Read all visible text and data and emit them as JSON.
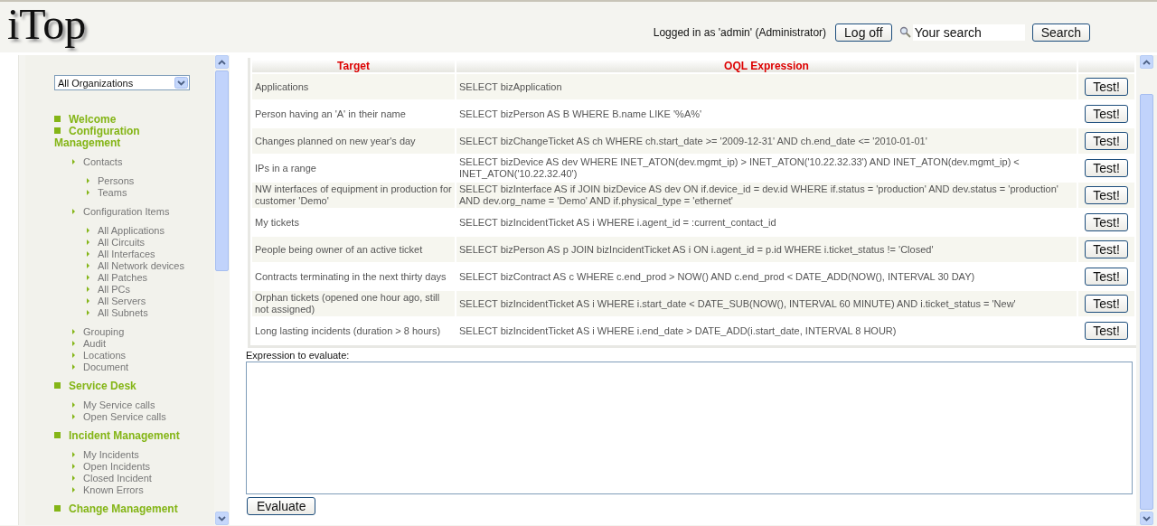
{
  "header": {
    "logo": "iTop",
    "login_text": "Logged in as 'admin' (Administrator)",
    "logoff_button": "Log off",
    "search": {
      "placeholder": "Your search"
    },
    "search_button": "Search"
  },
  "sidebar": {
    "organization_select": "All Organizations",
    "menu": [
      {
        "label": "Welcome"
      },
      {
        "label": "Configuration Management",
        "children": [
          {
            "label": "Contacts",
            "children": [
              {
                "label": "Persons"
              },
              {
                "label": "Teams"
              }
            ]
          },
          {
            "label": "Configuration Items",
            "children": [
              {
                "label": "All Applications"
              },
              {
                "label": "All Circuits"
              },
              {
                "label": "All Interfaces"
              },
              {
                "label": "All Network devices"
              },
              {
                "label": "All Patches"
              },
              {
                "label": "All PCs"
              },
              {
                "label": "All Servers"
              },
              {
                "label": "All Subnets"
              }
            ]
          },
          {
            "label": "Grouping"
          },
          {
            "label": "Audit"
          },
          {
            "label": "Locations"
          },
          {
            "label": "Document"
          }
        ]
      },
      {
        "label": "Service Desk",
        "children": [
          {
            "label": "My Service calls"
          },
          {
            "label": "Open Service calls"
          }
        ]
      },
      {
        "label": "Incident Management",
        "children": [
          {
            "label": "My Incidents"
          },
          {
            "label": "Open Incidents"
          },
          {
            "label": "Closed Incident"
          },
          {
            "label": "Known Errors"
          }
        ]
      },
      {
        "label": "Change Management"
      }
    ]
  },
  "queries": {
    "columns": [
      "Target",
      "OQL Expression"
    ],
    "rows": [
      {
        "target": "Applications",
        "expression": "SELECT bizApplication",
        "button": "Test!"
      },
      {
        "target": "Person having an 'A' in their name",
        "expression": "SELECT bizPerson AS B WHERE B.name LIKE '%A%'",
        "button": "Test!"
      },
      {
        "target": "Changes planned on new year's day",
        "expression": "SELECT bizChangeTicket AS ch WHERE ch.start_date >= '2009-12-31' AND ch.end_date <= '2010-01-01'",
        "button": "Test!"
      },
      {
        "target": "IPs in a range",
        "expression": "SELECT bizDevice AS dev WHERE INET_ATON(dev.mgmt_ip) > INET_ATON('10.22.32.33') AND INET_ATON(dev.mgmt_ip) < INET_ATON('10.22.32.40')",
        "button": "Test!"
      },
      {
        "target": "NW interfaces of equipment in production for customer 'Demo'",
        "expression": "SELECT bizInterface AS if JOIN bizDevice AS dev ON if.device_id = dev.id WHERE if.status = 'production' AND dev.status = 'production' AND dev.org_name = 'Demo' AND if.physical_type = 'ethernet'",
        "button": "Test!"
      },
      {
        "target": "My tickets",
        "expression": "SELECT bizIncidentTicket AS i WHERE i.agent_id = :current_contact_id",
        "button": "Test!"
      },
      {
        "target": "People being owner of an active ticket",
        "expression": "SELECT bizPerson AS p JOIN bizIncidentTicket AS i ON i.agent_id = p.id WHERE i.ticket_status != 'Closed'",
        "button": "Test!"
      },
      {
        "target": "Contracts terminating in the next thirty days",
        "expression": "SELECT bizContract AS c WHERE c.end_prod > NOW() AND c.end_prod < DATE_ADD(NOW(), INTERVAL 30 DAY)",
        "button": "Test!"
      },
      {
        "target": "Orphan tickets (opened one hour ago, still not assigned)",
        "expression": "SELECT bizIncidentTicket AS i WHERE i.start_date < DATE_SUB(NOW(), INTERVAL 60 MINUTE) AND i.ticket_status = 'New'",
        "button": "Test!"
      },
      {
        "target": "Long lasting incidents (duration > 8 hours)",
        "expression": "SELECT bizIncidentTicket AS i WHERE i.end_date > DATE_ADD(i.start_date, INTERVAL 8 HOUR)",
        "button": "Test!"
      }
    ]
  },
  "evaluate": {
    "label": "Expression to evaluate:",
    "button": "Evaluate"
  }
}
